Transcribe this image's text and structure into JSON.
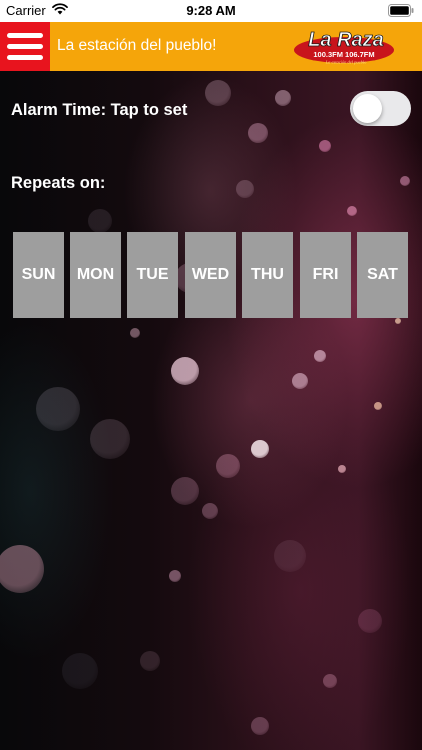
{
  "status_bar": {
    "carrier": "Carrier",
    "time": "9:28 AM",
    "icons": [
      "wifi-icon",
      "battery-icon"
    ]
  },
  "header": {
    "menu_icon": "hamburger-menu-icon",
    "tagline": "La estación del pueblo!",
    "logo": {
      "name": "La Raza",
      "freq1": "100.3FM",
      "freq2": "106.7FM",
      "slogan": "La estación del pueblo"
    },
    "colors": {
      "header_bg": "#f5a50a",
      "menu_bg": "#e8141e"
    }
  },
  "alarm": {
    "label": "Alarm Time: Tap to set",
    "enabled": false
  },
  "repeats": {
    "label": "Repeats on:",
    "days": [
      "SUN",
      "MON",
      "TUE",
      "WED",
      "THU",
      "FRI",
      "SAT"
    ],
    "day_color": "#9e9e9e"
  }
}
